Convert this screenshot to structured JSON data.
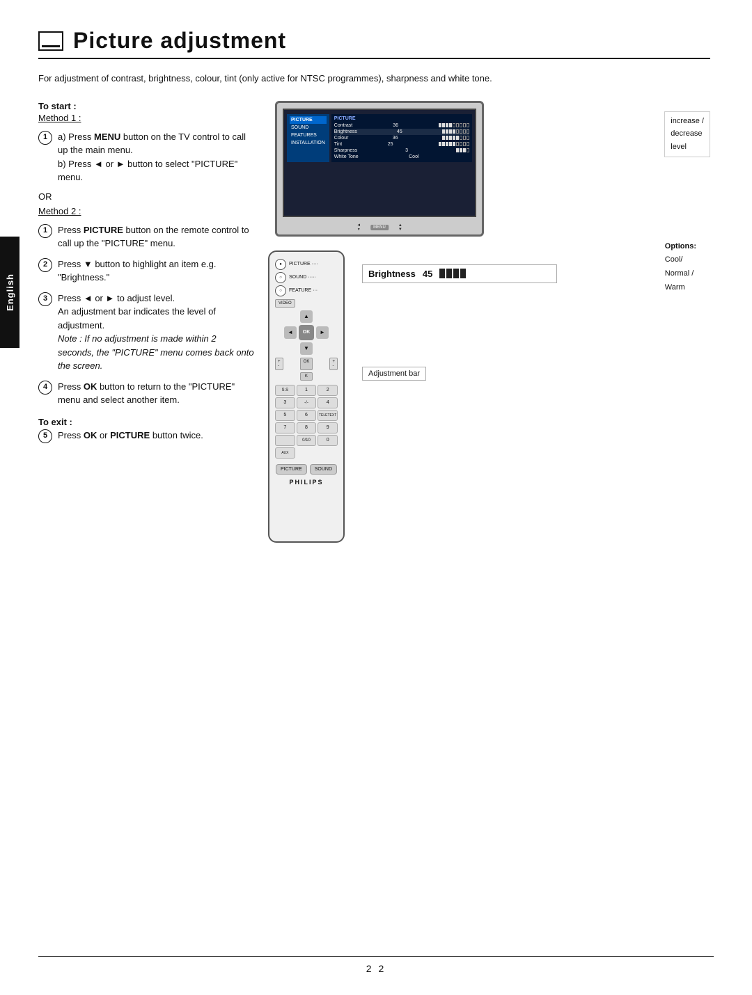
{
  "page": {
    "title": "Picture adjustment",
    "page_number": "2 2",
    "intro_text": "For adjustment of contrast, brightness, colour, tint (only active for NTSC programmes), sharpness and white tone."
  },
  "side_tab": {
    "label": "English"
  },
  "to_start": {
    "label": "To start :",
    "method1_label": "Method 1 :"
  },
  "method1_steps": [
    {
      "number": "1",
      "substeps": [
        "a) Press MENU button on the TV control to call up the main menu.",
        "b) Press ◄ or ► button to select \"PICTURE\" menu."
      ]
    }
  ],
  "or_label": "OR",
  "method2_label": "Method 2 :",
  "method2_steps": [
    {
      "number": "1",
      "text": "Press PICTURE button on the remote control to call up the \"PICTURE\" menu."
    },
    {
      "number": "2",
      "text": "Press ▼ button to highlight an item e.g. \"Brightness.\""
    },
    {
      "number": "3",
      "text": "Press ◄ or ► to adjust level.\nAn adjustment bar indicates the level of adjustment.\nNote : If no adjustment is made within 2 seconds, the \"PICTURE\" menu comes back onto the screen."
    },
    {
      "number": "4",
      "text": "Press OK button to return to the \"PICTURE\" menu and select another item."
    }
  ],
  "to_exit": {
    "label": "To exit :",
    "step": {
      "number": "5",
      "text": "Press OK or PICTURE button twice."
    }
  },
  "tv_menu": {
    "sidebar_items": [
      "PICTURE",
      "SOUND",
      "FEATURES",
      "INSTALLATION"
    ],
    "active_item": "PICTURE",
    "settings": [
      {
        "label": "Contrast",
        "value": "36",
        "filled": 4,
        "empty": 5
      },
      {
        "label": "Brightness",
        "value": "45",
        "filled": 4,
        "empty": 4
      },
      {
        "label": "Colour",
        "value": "36",
        "filled": 5,
        "empty": 3
      },
      {
        "label": "Tint",
        "value": "25",
        "filled": 5,
        "empty": 4
      },
      {
        "label": "Sharpness",
        "value": "3",
        "filled": 3,
        "empty": 1
      },
      {
        "label": "White Tone",
        "value": "Cool",
        "filled": 0,
        "empty": 0
      }
    ]
  },
  "legend": {
    "increase_label": "increase /",
    "decrease_label": "decrease",
    "level_label": "level"
  },
  "options_box": {
    "title": "Options:",
    "items": [
      "Cool/",
      "Normal /",
      "Warm"
    ]
  },
  "brightness_adj": {
    "label": "Brightness",
    "value": "45",
    "filled_bars": 4,
    "empty_bars": 0
  },
  "adjustment_bar_label": "Adjustment bar",
  "remote": {
    "menu_items": [
      "PICTURE",
      "SOUND",
      "FEATURES"
    ],
    "ok_label": "OK",
    "philips_label": "PHILIPS",
    "buttons": {
      "picture": "PICTURE",
      "sound": "SOUND",
      "num_keys": [
        "1",
        "2",
        "3",
        "4",
        "5",
        "6",
        "7",
        "8",
        "9"
      ],
      "bottom_left": "PICTURE",
      "bottom_right": "SOUND"
    }
  }
}
